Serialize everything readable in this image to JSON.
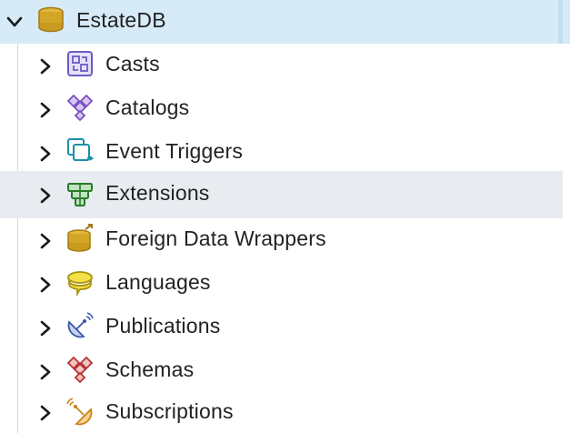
{
  "tree": {
    "root": {
      "label": "EstateDB",
      "icon": "database-icon",
      "expanded": true
    },
    "children": [
      {
        "label": "Casts",
        "icon": "casts-icon"
      },
      {
        "label": "Catalogs",
        "icon": "catalogs-icon"
      },
      {
        "label": "Event Triggers",
        "icon": "event-triggers-icon"
      },
      {
        "label": "Extensions",
        "icon": "extensions-icon"
      },
      {
        "label": "Foreign Data Wrappers",
        "icon": "foreign-data-wrappers-icon"
      },
      {
        "label": "Languages",
        "icon": "languages-icon"
      },
      {
        "label": "Publications",
        "icon": "publications-icon"
      },
      {
        "label": "Schemas",
        "icon": "schemas-icon"
      },
      {
        "label": "Subscriptions",
        "icon": "subscriptions-icon"
      }
    ]
  },
  "colors": {
    "selected_row": "#d6eaf8",
    "hover_row": "#e8ebef",
    "text": "#222222"
  }
}
